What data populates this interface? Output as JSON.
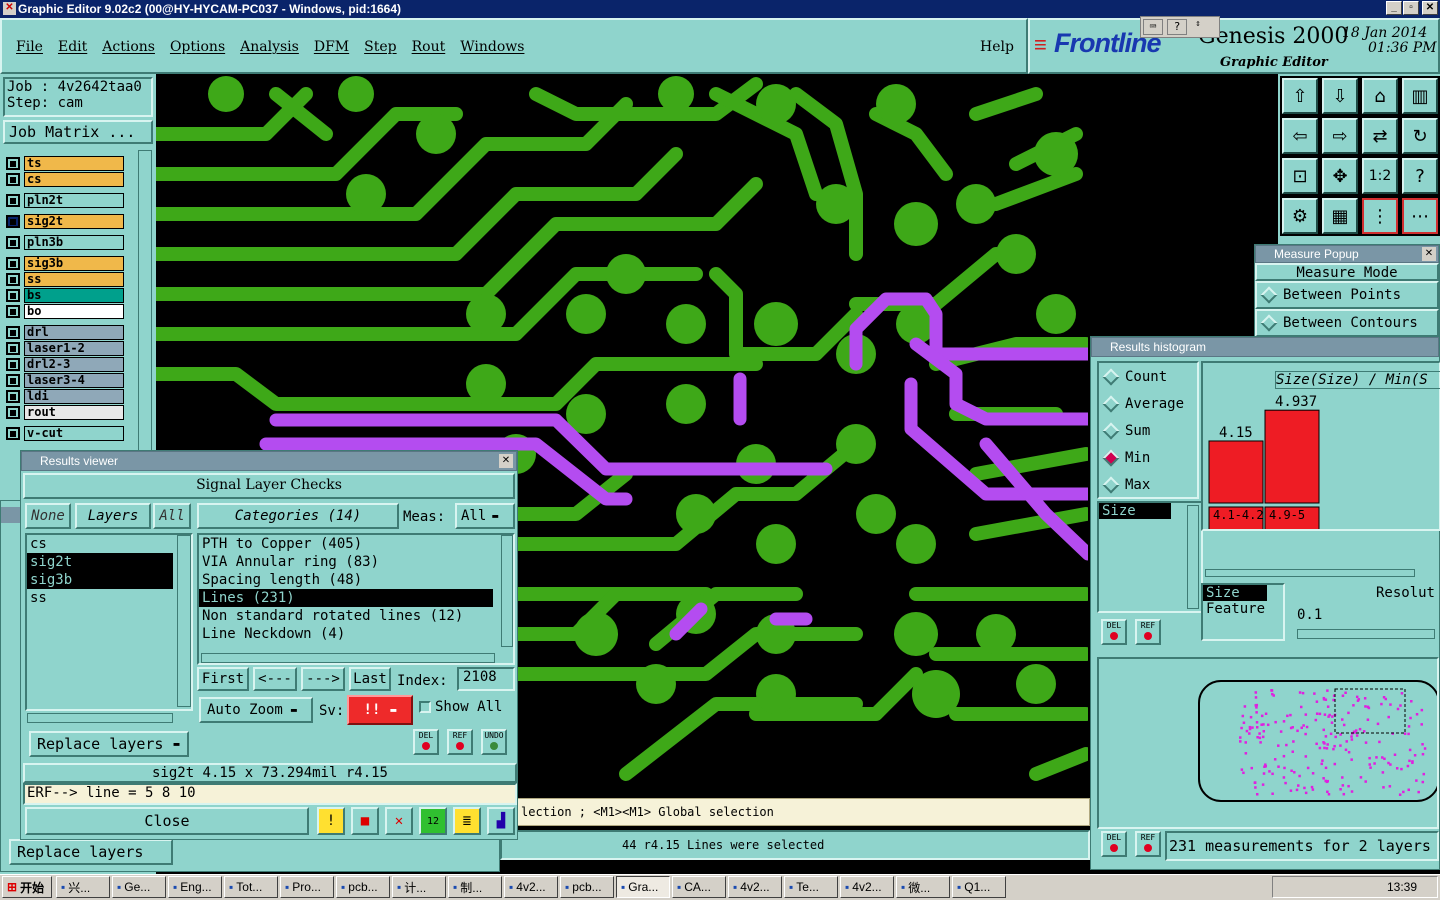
{
  "window": {
    "title": "Graphic Editor 9.02c2 (00@HY-HYCAM-PC037 - Windows, pid:1664)",
    "min": "_",
    "max": "▫",
    "close": "✕"
  },
  "menu": [
    "File",
    "Edit",
    "Actions",
    "Options",
    "Analysis",
    "DFM",
    "Step",
    "Rout",
    "Windows"
  ],
  "help": "Help",
  "brand": {
    "logo": "Frontline",
    "product": "Genesis 2000",
    "date": "18 Jan 2014",
    "time": "01:36 PM",
    "subtitle": "Graphic Editor"
  },
  "job": {
    "job_label": "Job : 4v2642taa0",
    "step_label": "Step: cam",
    "matrix_button": "Job Matrix ..."
  },
  "layers": [
    {
      "name": "ts",
      "color": "#f0b84a"
    },
    {
      "name": "cs",
      "color": "#f0b84a"
    },
    {
      "name": "pln2t",
      "color": "#8fd4cc"
    },
    {
      "name": "sig2t",
      "color": "#f0b84a"
    },
    {
      "name": "pln3b",
      "color": "#8fd4cc"
    },
    {
      "name": "sig3b",
      "color": "#f0b84a"
    },
    {
      "name": "ss",
      "color": "#f0b84a"
    },
    {
      "name": "bs",
      "color": "#00a08c"
    },
    {
      "name": "bo",
      "color": "#ffffff"
    },
    {
      "name": "drl",
      "color": "#8fa8b8"
    },
    {
      "name": "laser1-2",
      "color": "#8fa8b8"
    },
    {
      "name": "drl2-3",
      "color": "#8fa8b8"
    },
    {
      "name": "laser3-4",
      "color": "#8fa8b8"
    },
    {
      "name": "ldi",
      "color": "#8fa8b8"
    },
    {
      "name": "rout",
      "color": "#e8e8e8"
    },
    {
      "name": "v-cut",
      "color": "#8fd4cc"
    }
  ],
  "results_viewer": {
    "title": "Results viewer",
    "heading": "Signal Layer Checks",
    "none": "None",
    "layers_btn": "Layers",
    "all": "All",
    "categories_btn": "Categories (14)",
    "meas_label": "Meas:",
    "meas_value": "All",
    "layer_list": [
      "cs",
      "sig2t",
      "sig3b",
      "ss"
    ],
    "categories": [
      "PTH to Copper (405)",
      "VIA Annular ring (83)",
      "Spacing length (48)",
      "Lines (231)",
      "Non standard rotated lines (12)",
      "Line Neckdown (4)"
    ],
    "nav": {
      "first": "First",
      "prev": "<---",
      "next": "--->",
      "last": "Last",
      "index_label": "Index:",
      "index_value": "2108"
    },
    "auto_zoom": "Auto Zoom",
    "sv_label": "Sv:",
    "sv_value": "!!",
    "show_all": "Show All",
    "replace_layers": "Replace layers",
    "del": "DEL",
    "ref": "REF",
    "undo": "UNDO",
    "status": "sig2t 4.15 x 73.294mil  r4.15",
    "erf": "ERF--> line = 5 8 10",
    "close": "Close"
  },
  "back_replace": "Replace layers",
  "status_line": "lection ; <M1><M1> Global selection",
  "selected_msg": "44 r4.15 Lines were selected",
  "measure": {
    "title": "Measure Popup",
    "mode": "Measure Mode",
    "between_points": "Between Points",
    "between_contours": "Between Contours"
  },
  "histogram": {
    "title": "Results histogram",
    "options": [
      "Count",
      "Average",
      "Sum",
      "Min",
      "Max"
    ],
    "selected": "Min",
    "attr_list": [
      "Size"
    ],
    "chart_title": "Size(Size) / Min(S",
    "bars": [
      {
        "label": "4.15",
        "range": "4.1-4.2"
      },
      {
        "label": "4.937",
        "range": "4.9-5"
      }
    ],
    "bar_values": [
      4.15,
      4.937
    ],
    "size_label": "Size",
    "feature_label": "Feature",
    "resolution_label": "Resolut",
    "resolution_value": "0.1",
    "summary": "231 measurements for 2 layers"
  },
  "taskbar": {
    "start": "开始",
    "time": "13:39",
    "items": [
      "兴...",
      "Ge...",
      "Eng...",
      "Tot...",
      "Pro...",
      "pcb...",
      "计...",
      "制...",
      "4v2...",
      "pcb...",
      "Gra...",
      "CA...",
      "4v2...",
      "Te...",
      "4v2...",
      "微...",
      "Q1..."
    ]
  }
}
